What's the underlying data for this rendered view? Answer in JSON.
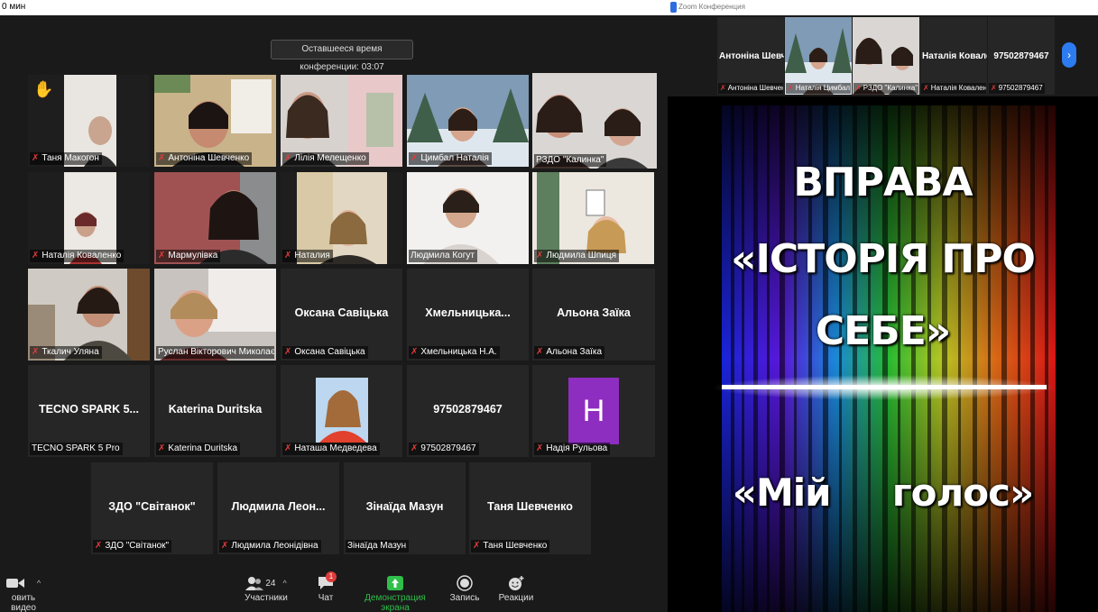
{
  "top": {
    "left_text": "0 мин",
    "right_title": "Zoom Конференция"
  },
  "timer": "Оставшееся время конференции: 03:07",
  "tiles": [
    {
      "name": "Таня Макогон",
      "muted": true
    },
    {
      "name": "Антоніна Шевченко",
      "muted": true
    },
    {
      "name": "Лілія Мелещенко",
      "muted": true
    },
    {
      "name": "Цимбал Наталія",
      "muted": true
    },
    {
      "name": "РЗДО \"Калинка\"",
      "muted": true
    },
    {
      "name": "Наталія Коваленко",
      "muted": true
    },
    {
      "name": "Мармулівка",
      "muted": true
    },
    {
      "name": "Наталия",
      "muted": true
    },
    {
      "name": "Людмила Когут",
      "muted": false
    },
    {
      "name": "Людмила Шпиця",
      "muted": true
    },
    {
      "name": "Ткалич Уляна",
      "muted": true
    },
    {
      "name": "Руслан Вікторович Миколаєнко",
      "muted": false
    },
    {
      "name": "Оксана Савіцька",
      "center": "Оксана Савіцька",
      "muted": true
    },
    {
      "name": "Хмельницька Н.А.",
      "center": "Хмельницька...",
      "muted": true
    },
    {
      "name": "Альона Заїка",
      "center": "Альона Заїка",
      "muted": true
    },
    {
      "name": "TECNO SPARK 5 Pro",
      "center": "TECNO SPARK 5...",
      "muted": false
    },
    {
      "name": "Katerina Duritska",
      "center": "Katerina Duritska",
      "muted": true
    },
    {
      "name": "Наташа Медведева",
      "muted": true
    },
    {
      "name": "97502879467",
      "center": "97502879467",
      "muted": true
    },
    {
      "name": "Надія Рульова",
      "avatar": "H",
      "muted": true
    },
    {
      "name": "ЗДО \"Світанок\"",
      "center": "ЗДО \"Світанок\"",
      "muted": true
    },
    {
      "name": "Людмила Леонідівна",
      "center": "Людмила  Леон...",
      "muted": true
    },
    {
      "name": "Зінаїда Мазун",
      "center": "Зінаїда Мазун",
      "muted": false
    },
    {
      "name": "Таня Шевченко",
      "center": "Таня Шевченко",
      "muted": true
    }
  ],
  "toolbar": {
    "video_label": "овить видео",
    "participants_label": "Участники",
    "participants_count": "24",
    "chat_label": "Чат",
    "chat_badge": "1",
    "share_label": "Демонстрация экрана",
    "record_label": "Запись",
    "reactions_label": "Реакции"
  },
  "strip": [
    {
      "center": "Антоніна Шевч...",
      "label": "Антоніна Шевченко",
      "muted": true
    },
    {
      "label": "Наталія Цимбал",
      "muted": true
    },
    {
      "label": "РЗДО \"Калинка\"",
      "muted": true
    },
    {
      "center": "Наталія Ковале...",
      "label": "Наталія Коваленко",
      "muted": true
    },
    {
      "center": "97502879467",
      "label": "97502879467",
      "muted": true
    }
  ],
  "slide": {
    "line1": "ВПРАВА",
    "line2": "«ІСТОРІЯ ПРО",
    "line3": "СЕБЕ»",
    "line4": "«Мій     голос»"
  },
  "colors": {
    "speaker_border": "#c8e060",
    "muted": "#e03b3b",
    "share_green": "#2fbf4a",
    "avatar": "#8e2ec0",
    "accent": "#2d7bf0"
  }
}
